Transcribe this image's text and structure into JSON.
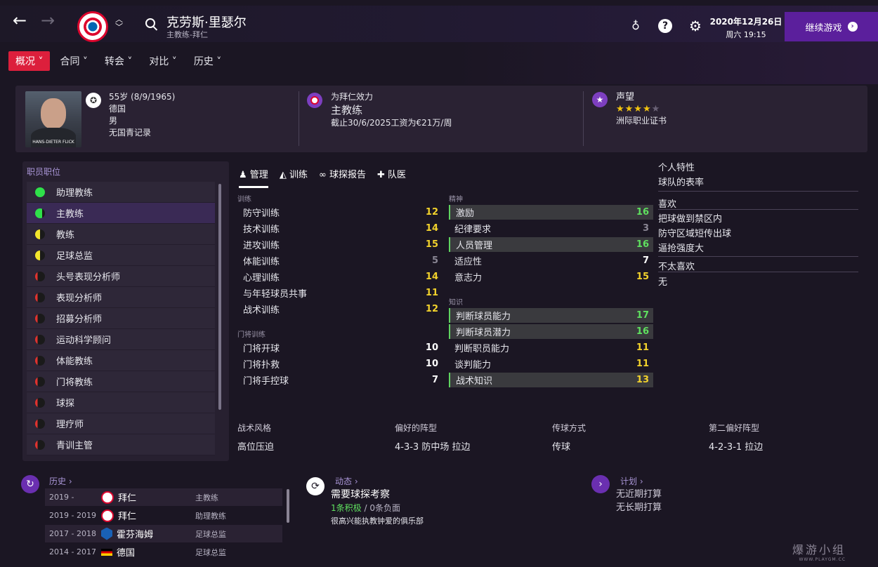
{
  "header": {
    "back_icon": "←",
    "forward_icon": "→",
    "name": "克劳斯·里瑟尔",
    "subtitle": "主教练-拜仁",
    "date": "2020年12月26日",
    "day_time": "周六 19:15",
    "continue_label": "继续游戏"
  },
  "tabs": [
    {
      "label": "概况",
      "active": true
    },
    {
      "label": "合同"
    },
    {
      "label": "转会"
    },
    {
      "label": "对比"
    },
    {
      "label": "历史"
    }
  ],
  "profile": {
    "age_line": "55岁 (8/9/1965)",
    "nation": "德国",
    "gender": "男",
    "youth": "无国青记录",
    "photo_caption": "HANS-DIETER FLICK",
    "club_line": "为拜仁效力",
    "role": "主教练",
    "contract": "截止30/6/2025工资为€21万/周",
    "rep_title": "声望",
    "rep_stars": 4,
    "license": "洲际职业证书"
  },
  "staff_roles": {
    "title": "职员职位",
    "items": [
      {
        "label": "助理教练",
        "level": "full"
      },
      {
        "label": "主教练",
        "level": "high"
      },
      {
        "label": "教练",
        "level": "mid"
      },
      {
        "label": "足球总监",
        "level": "mid"
      },
      {
        "label": "头号表现分析师",
        "level": "low"
      },
      {
        "label": "表现分析师",
        "level": "low"
      },
      {
        "label": "招募分析师",
        "level": "low"
      },
      {
        "label": "运动科学顾问",
        "level": "low"
      },
      {
        "label": "体能教练",
        "level": "low"
      },
      {
        "label": "门将教练",
        "level": "low"
      },
      {
        "label": "球探",
        "level": "low"
      },
      {
        "label": "理疗师",
        "level": "low"
      },
      {
        "label": "青训主管",
        "level": "low"
      }
    ]
  },
  "sub_tabs": [
    "管理",
    "训练",
    "球探报告",
    "队医"
  ],
  "attributes": {
    "training_title": "训练",
    "training": [
      {
        "label": "防守训练",
        "value": "12"
      },
      {
        "label": "技术训练",
        "value": "14"
      },
      {
        "label": "进攻训练",
        "value": "15"
      },
      {
        "label": "体能训练",
        "value": "5"
      },
      {
        "label": "心理训练",
        "value": "14"
      },
      {
        "label": "与年轻球员共事",
        "value": "11"
      },
      {
        "label": "战术训练",
        "value": "12"
      }
    ],
    "gk_title": "门将训练",
    "gk": [
      {
        "label": "门将开球",
        "value": "10"
      },
      {
        "label": "门将扑救",
        "value": "10"
      },
      {
        "label": "门将手控球",
        "value": "7"
      }
    ],
    "mental_title": "精神",
    "mental": [
      {
        "label": "激励",
        "value": "16"
      },
      {
        "label": "纪律要求",
        "value": "3"
      },
      {
        "label": "人员管理",
        "value": "16"
      },
      {
        "label": "适应性",
        "value": "7"
      },
      {
        "label": "意志力",
        "value": "15"
      }
    ],
    "knowledge_title": "知识",
    "knowledge": [
      {
        "label": "判断球员能力",
        "value": "17"
      },
      {
        "label": "判断球员潜力",
        "value": "16"
      },
      {
        "label": "判断职员能力",
        "value": "11"
      },
      {
        "label": "谈判能力",
        "value": "11"
      },
      {
        "label": "战术知识",
        "value": "13"
      }
    ]
  },
  "traits": {
    "title": "个人特性",
    "subtitle": "球队的表率",
    "likes_title": "喜欢",
    "likes": [
      "把球做到禁区内",
      "防守区域短传出球",
      "逼抢强度大"
    ],
    "dislikes_title": "不太喜欢",
    "dislikes": [
      "无"
    ]
  },
  "style": [
    {
      "k": "战术风格",
      "v": "高位压迫"
    },
    {
      "k": "偏好的阵型",
      "v": "4-3-3 防中场 拉边"
    },
    {
      "k": "传球方式",
      "v": "传球"
    },
    {
      "k": "第二偏好阵型",
      "v": "4-2-3-1 拉边"
    }
  ],
  "history": {
    "title": "历史",
    "rows": [
      {
        "years": "2019 -",
        "club": "拜仁",
        "job": "主教练",
        "badge": "bayern"
      },
      {
        "years": "2019 - 2019",
        "club": "拜仁",
        "job": "助理教练",
        "badge": "bayern"
      },
      {
        "years": "2017 - 2018",
        "club": "霍芬海姆",
        "job": "足球总监",
        "badge": "hoff"
      },
      {
        "years": "2014 - 2017",
        "club": "德国",
        "job": "足球总监",
        "badge": "de"
      }
    ]
  },
  "news": {
    "title": "动态",
    "headline": "需要球探考察",
    "positive": "1条积极",
    "sep": "/",
    "negative": "0条负面",
    "desc": "很高兴能执教钟爱的俱乐部"
  },
  "plans": {
    "title": "计划",
    "line1": "无近期打算",
    "line2": "无长期打算"
  },
  "watermark": {
    "main": "爆游小组",
    "sub": "WWW.PLAYGM.CC"
  }
}
